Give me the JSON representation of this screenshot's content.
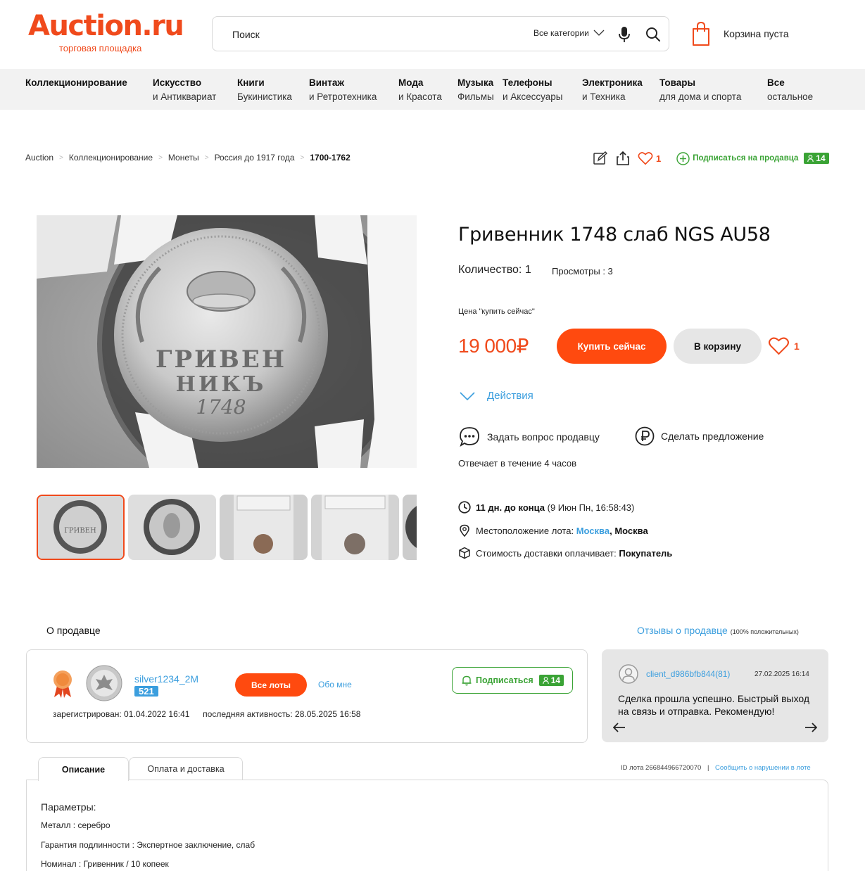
{
  "header": {
    "logo": "Auction.ru",
    "logo_sub": "торговая площадка",
    "search_placeholder": "Поиск",
    "category_select": "Все категории",
    "cart_label": "Корзина пуста"
  },
  "categories": [
    {
      "title": "Коллекционирование",
      "sub": ""
    },
    {
      "title": "Искусство",
      "sub": "и Антиквариат"
    },
    {
      "title": "Книги",
      "sub": "Букинистика"
    },
    {
      "title": "Винтаж",
      "sub": "и Ретротехника"
    },
    {
      "title": "Мода",
      "sub": "и Красота"
    },
    {
      "title": "Музыка",
      "sub": "Фильмы"
    },
    {
      "title": "Телефоны",
      "sub": "и Аксессуары"
    },
    {
      "title": "Электроника",
      "sub": "и Техника"
    },
    {
      "title": "Товары",
      "sub": "для дома и спорта"
    },
    {
      "title": "Все",
      "sub": "остальное"
    }
  ],
  "breadcrumb": [
    "Auction",
    "Коллекционирование",
    "Монеты",
    "Россия до 1917 года",
    "1700-1762"
  ],
  "top_actions": {
    "favorites_count": "1",
    "subscribe_label": "Подписаться на продавца",
    "subscribers": "14"
  },
  "product": {
    "title": "Гривенник 1748 слаб NGS AU58",
    "quantity": "Количество: 1",
    "views": "Просмотры : 3",
    "price_label": "Цена \"купить сейчас\"",
    "price": "19 000₽",
    "buy_now": "Купить сейчас",
    "add_to_cart": "В корзину",
    "favorites": "1",
    "actions": "Действия",
    "ask_seller": "Задать вопрос продавцу",
    "make_offer": "Сделать предложение",
    "responds": "Отвечает в течение 4 часов",
    "time_left": "11 дн. до конца",
    "end_date": "(9 Июн Пн, 16:58:43)",
    "location_label": "Местоположение лота:",
    "location_city": "Москва",
    "location_region": ", Москва",
    "shipping_label": "Стоимость доставки оплачивает:",
    "shipping_payer": "Покупатель"
  },
  "seller": {
    "section_title": "О продавце",
    "reviews_link": "Отзывы о продавце",
    "reviews_note": "(100% положительных)",
    "name": "silver1234_2M",
    "rating": "521",
    "all_lots": "Все лоты",
    "about_me": "Обо мне",
    "subscribe": "Подписаться",
    "subscribers": "14",
    "registered": "зарегистрирован: 01.04.2022 16:41",
    "last_activity": "последняя активность: 28.05.2025 16:58"
  },
  "review": {
    "user": "client_d986bfb844(81)",
    "date": "27.02.2025 16:14",
    "text": "Сделка прошла успешно. Быстрый выход на связь и отправка. Рекомендую!"
  },
  "tabs": {
    "description": "Описание",
    "payment": "Оплата и доставка",
    "lot_id": "ID лота 266844966720070",
    "separator": "|",
    "report": "Сообщить о нарушении в лоте"
  },
  "params": {
    "title": "Параметры:",
    "metal": "Металл : серебро",
    "guarantee": "Гарантия подлинности : Экспертное заключение, слаб",
    "nominal": "Номинал : Гривенник / 10 копеек"
  },
  "colors": {
    "brand": "#f04a1c",
    "button": "#ff4a0f",
    "link": "#3b9ede",
    "green": "#3aa335"
  }
}
